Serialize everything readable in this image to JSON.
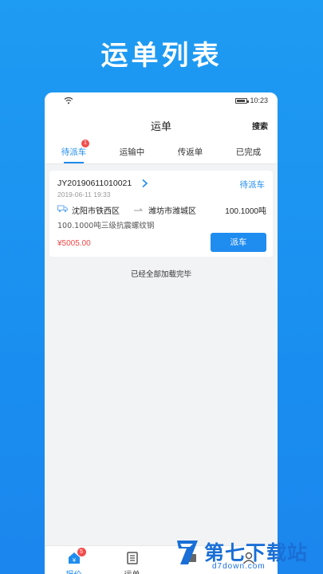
{
  "headline": "运单列表",
  "statusbar": {
    "time": "10:23"
  },
  "nav": {
    "title": "运单",
    "search_label": "搜索"
  },
  "tabs": [
    {
      "label": "待派车",
      "badge": "1",
      "active": true
    },
    {
      "label": "运输中"
    },
    {
      "label": "传返单"
    },
    {
      "label": "已完成"
    }
  ],
  "order": {
    "number": "JY20190611010021",
    "status": "待派车",
    "time": "2019-06-11 19:33",
    "from": "沈阳市铁西区",
    "to": "潍坊市潍城区",
    "weight": "100.1000吨",
    "cargo": "100.1000吨三级抗震螺纹钢",
    "price": "¥5005.00",
    "action_label": "派车"
  },
  "list_footer": "已经全部加载完毕",
  "tabbar": [
    {
      "label": "报价",
      "icon": "quote-icon",
      "badge": "5",
      "active": true
    },
    {
      "label": "运单",
      "icon": "waybill-icon"
    },
    {
      "label": "",
      "icon": "vehicle-icon"
    },
    {
      "label": "",
      "icon": "profile-icon"
    }
  ],
  "watermark": {
    "title": "第七下载站",
    "sub": "d7down.com"
  },
  "colors": {
    "accent": "#1f8cf0",
    "price": "#f04848",
    "badge": "#f14c4c",
    "background": "#1b8ff0"
  }
}
